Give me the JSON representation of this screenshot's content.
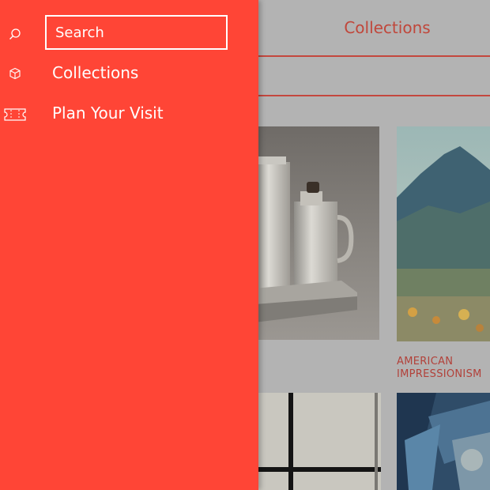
{
  "drawer": {
    "search": {
      "placeholder": "Search",
      "icon": "search-icon"
    },
    "items": [
      {
        "label": "Collections",
        "icon": "cube-icon"
      },
      {
        "label": "Plan Your Visit",
        "icon": "ticket-icon"
      }
    ]
  },
  "page": {
    "header": {
      "title": "Collections"
    },
    "cards": [
      {
        "caption": "",
        "image": "silver tea set photo"
      },
      {
        "caption": "AMERICAN IMPRESSIONISM",
        "image": "mountain landscape painting"
      },
      {
        "caption": "",
        "image": "grid abstract painting"
      },
      {
        "caption": "",
        "image": "blue abstract painting"
      }
    ]
  },
  "colors": {
    "drawer_background": "#ff4536",
    "overlay_background": "#b3b3b3",
    "accent": "#c0473b",
    "drawer_text": "#ffffff"
  }
}
